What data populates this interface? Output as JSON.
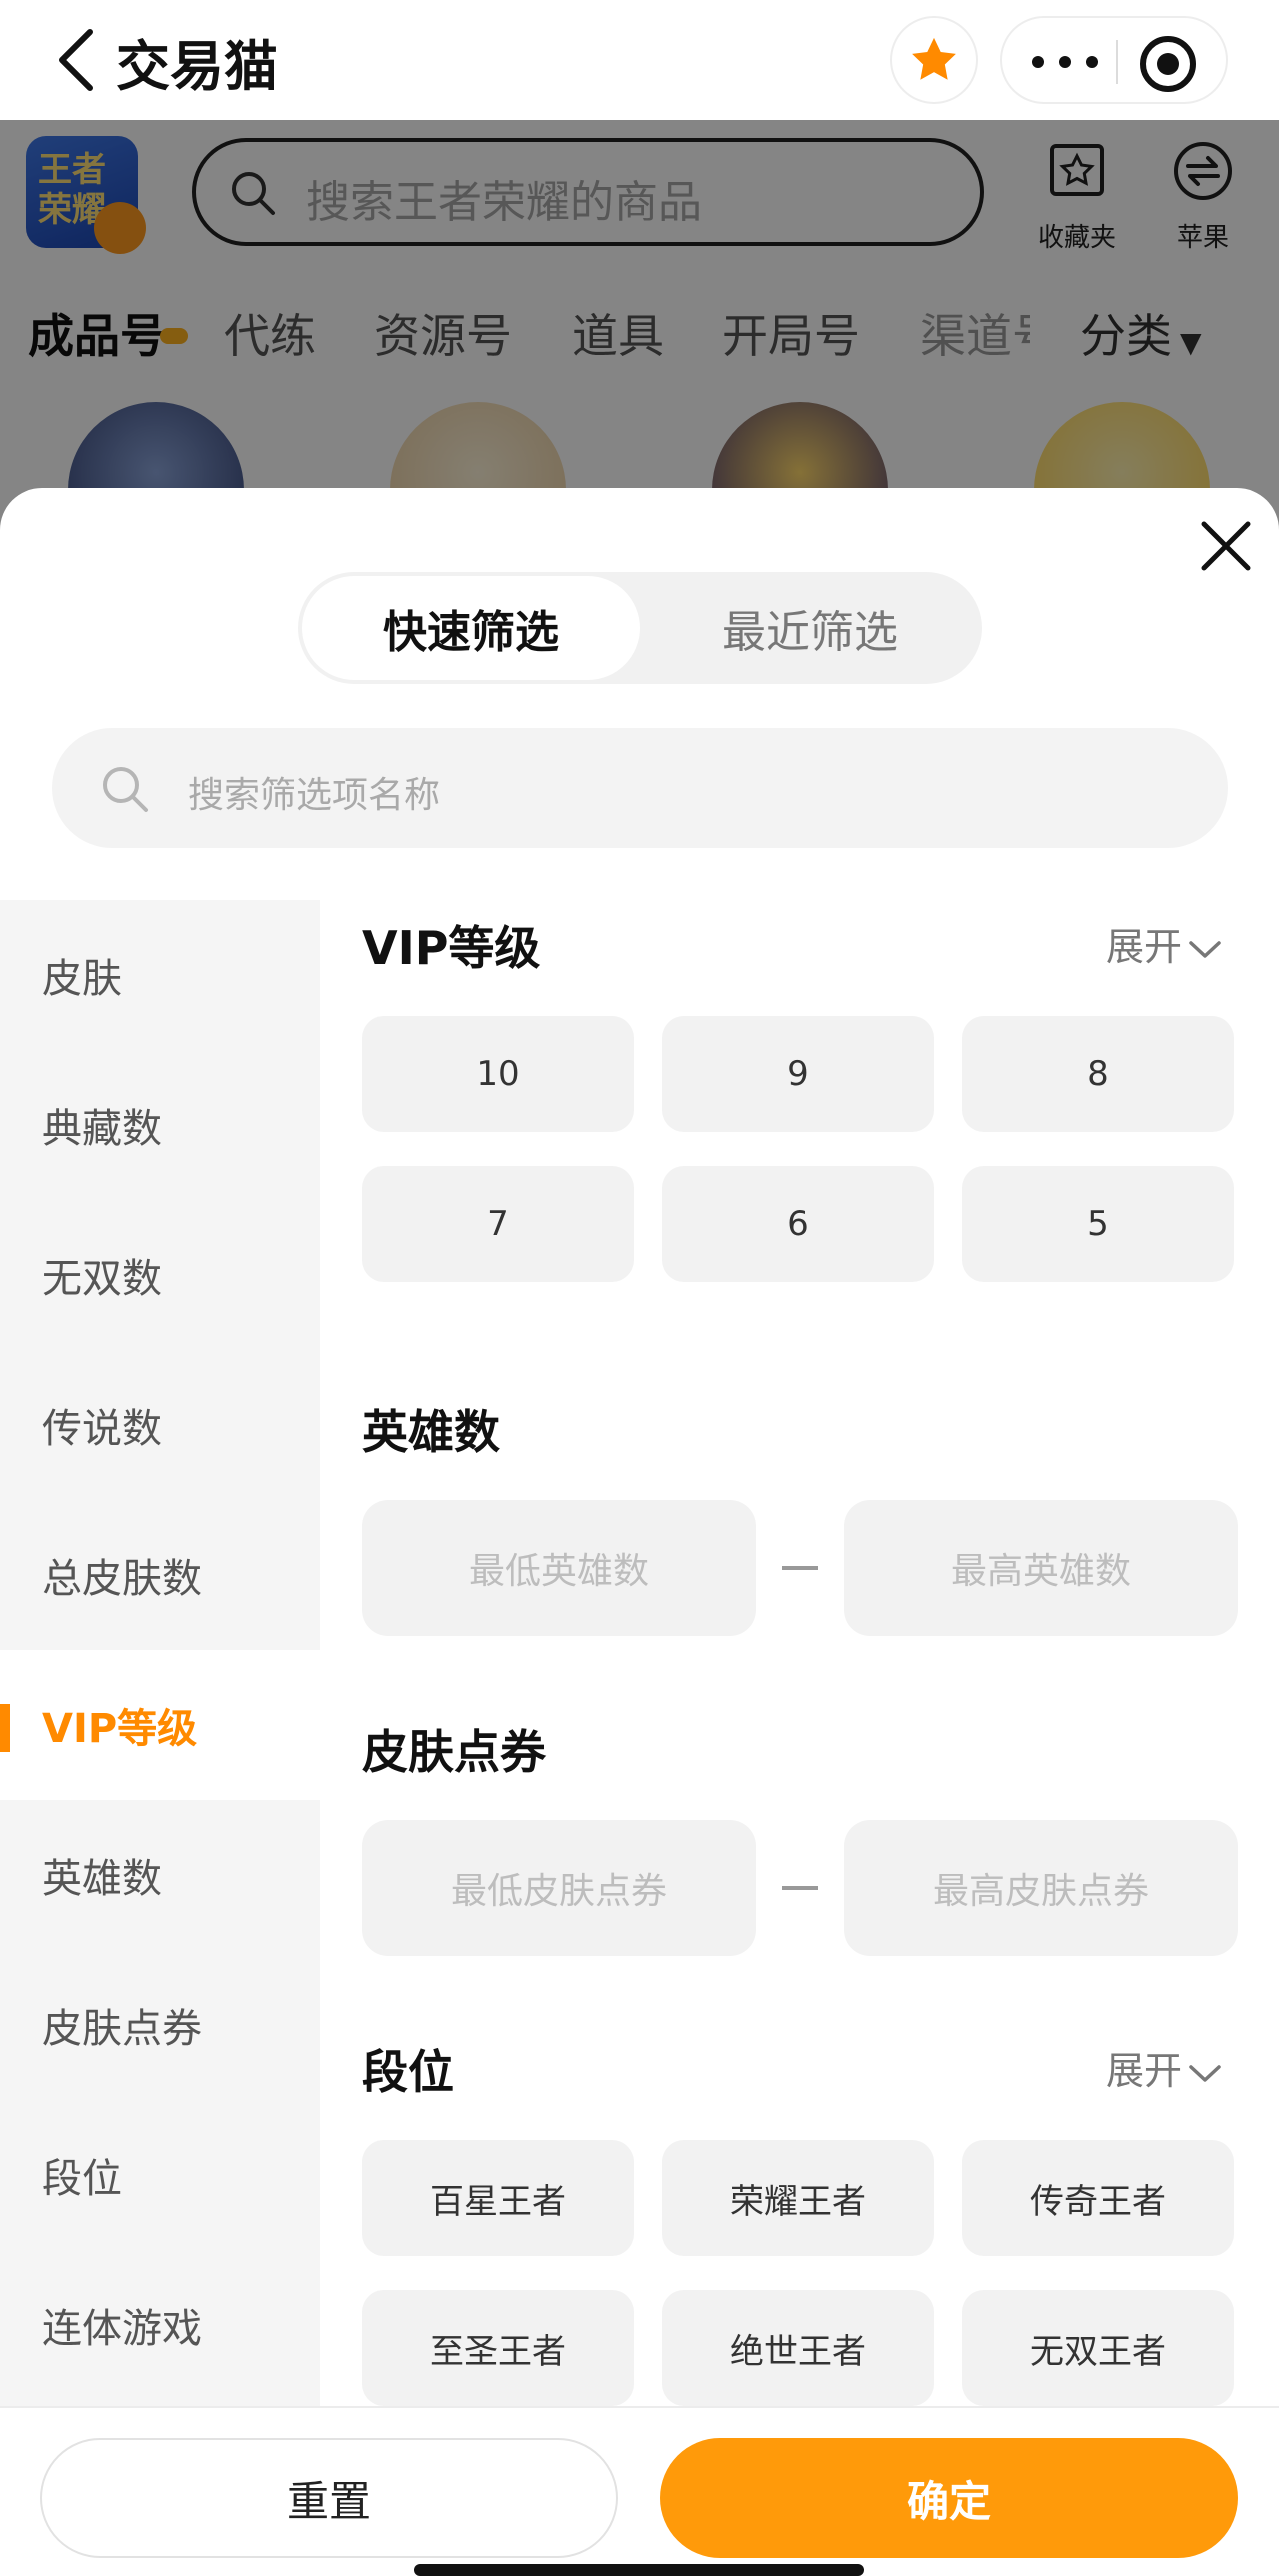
{
  "app": {
    "title": "交易猫"
  },
  "background": {
    "search_placeholder": "搜索王者荣耀的商品",
    "game_icon_text": "王者荣耀",
    "tools": [
      {
        "label": "收藏夹",
        "icon": "favorites-icon"
      },
      {
        "label": "苹果",
        "icon": "swap-icon"
      }
    ],
    "tabs": [
      "成品号",
      "代练",
      "资源号",
      "道具",
      "开局号",
      "渠道号"
    ],
    "category_label": "分类"
  },
  "filter": {
    "segments": {
      "active": "快速筛选",
      "inactive": "最近筛选"
    },
    "search_placeholder": "搜索筛选项名称",
    "sidebar": [
      "皮肤",
      "典藏数",
      "无双数",
      "传说数",
      "总皮肤数",
      "VIP等级",
      "英雄数",
      "皮肤点券",
      "段位",
      "连体游戏"
    ],
    "active_sidebar_index": 5,
    "expand_label": "展开",
    "vip": {
      "title": "VIP等级",
      "options": [
        "10",
        "9",
        "8",
        "7",
        "6",
        "5"
      ]
    },
    "hero": {
      "title": "英雄数",
      "min_placeholder": "最低英雄数",
      "max_placeholder": "最高英雄数"
    },
    "skin_coupon": {
      "title": "皮肤点券",
      "min_placeholder": "最低皮肤点券",
      "max_placeholder": "最高皮肤点券"
    },
    "rank": {
      "title": "段位",
      "options": [
        "百星王者",
        "荣耀王者",
        "传奇王者",
        "至圣王者",
        "绝世王者",
        "无双王者"
      ]
    }
  },
  "footer": {
    "reset_label": "重置",
    "confirm_label": "确定"
  },
  "colors": {
    "accent": "#ff8a00",
    "confirm": "#ff9a0a"
  }
}
